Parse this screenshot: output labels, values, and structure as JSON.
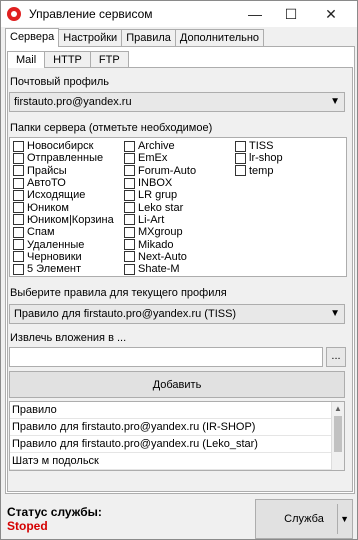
{
  "window": {
    "title": "Управление сервисом",
    "minimize": "—",
    "maximize": "☐",
    "close": "✕"
  },
  "tabs": [
    "Сервера",
    "Настройки",
    "Правила",
    "Дополнительно"
  ],
  "subtabs": [
    "Mail",
    "HTTP",
    "FTP"
  ],
  "profile": {
    "label": "Почтовый профиль",
    "value": "firstauto.pro@yandex.ru"
  },
  "folders": {
    "label": "Папки сервера (отметьте необходимое)",
    "col1": [
      "Новосибирск",
      "Отправленные",
      "Прайсы",
      "АвтоТО",
      "Исходящие",
      "Юником",
      "Юником|Корзина",
      "Спам",
      "Удаленные",
      "Черновики",
      "5 Элемент"
    ],
    "col2": [
      "Archive",
      "EmEx",
      "Forum-Auto",
      "INBOX",
      "LR grup",
      "Leko star",
      "Li-Art",
      "MXgroup",
      "Mikado",
      "Next-Auto",
      "Shate-M"
    ],
    "col3": [
      "TISS",
      "lr-shop",
      "temp"
    ]
  },
  "rules_select": {
    "label": "Выберите правила для текущего профиля",
    "value": "Правило для firstauto.pro@yandex.ru (TISS)"
  },
  "attachments": {
    "label": "Извлечь вложения в ...",
    "value": "",
    "browse": "..."
  },
  "add_button": "Добавить",
  "rules_list": [
    "Правило",
    "Правило для firstauto.pro@yandex.ru (IR-SHOP)",
    "Правило для firstauto.pro@yandex.ru (Leko_star)",
    "Шатэ м подольск"
  ],
  "service": {
    "status_label": "Статус службы:",
    "status_value": "Stoped",
    "button": "Служба"
  }
}
